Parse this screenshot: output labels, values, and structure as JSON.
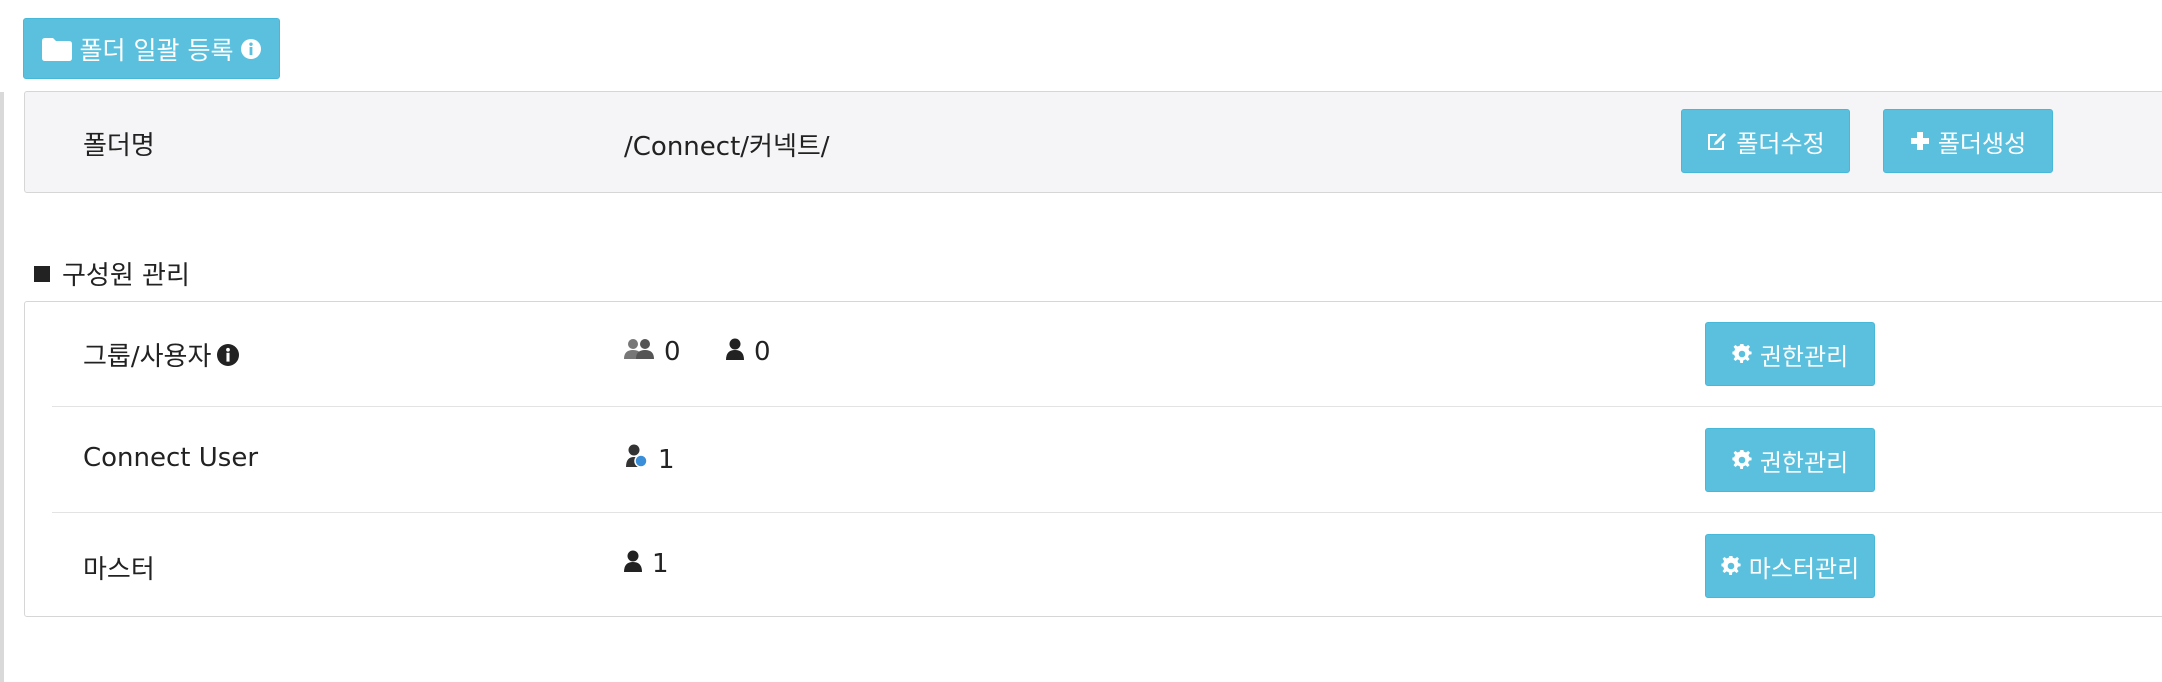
{
  "toolbar": {
    "bulk_register_label": "폴더 일괄 등록"
  },
  "folder": {
    "label": "폴더명",
    "path": "/Connect/커넥트/",
    "edit_label": "폴더수정",
    "create_label": "폴더생성"
  },
  "members": {
    "section_title": "구성원 관리",
    "rows": [
      {
        "label": "그룹/사용자",
        "group_count": "0",
        "user_count": "0",
        "button_label": "권한관리"
      },
      {
        "label": "Connect User",
        "user_count": "1",
        "button_label": "권한관리"
      },
      {
        "label": "마스터",
        "user_count": "1",
        "button_label": "마스터관리"
      }
    ]
  },
  "colors": {
    "accent": "#5bc0de",
    "panel_bg": "#f5f5f7",
    "border": "#d6d6d6"
  },
  "icons": [
    "folder-icon",
    "info-icon",
    "edit-icon",
    "plus-icon",
    "group-icon",
    "user-icon",
    "connect-user-icon",
    "gear-icon"
  ]
}
